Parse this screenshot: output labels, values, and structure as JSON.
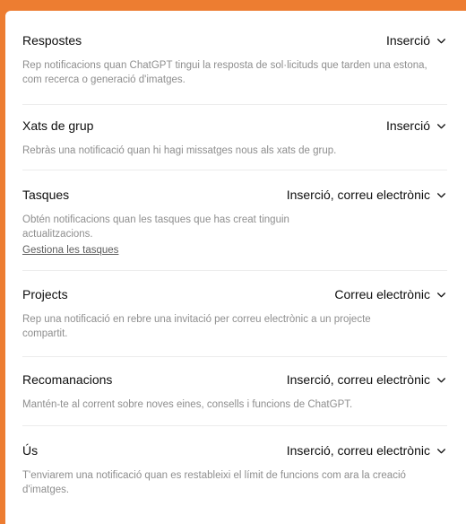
{
  "sections": [
    {
      "title": "Respostes",
      "value": "Inserció",
      "description": "Rep notificacions quan ChatGPT tingui la resposta de sol·licituds que tarden una estona, com recerca o generació d'imatges."
    },
    {
      "title": "Xats de grup",
      "value": "Inserció",
      "description": "Rebràs una notificació quan hi hagi missatges nous als xats de grup."
    },
    {
      "title": "Tasques",
      "value": "Inserció, correu electrònic",
      "description": "Obtén notificacions quan les tasques que has creat tinguin actualitzacions.",
      "link": "Gestiona les tasques"
    },
    {
      "title": "Projects",
      "value": "Correu electrònic",
      "description": "Rep una notificació en rebre una invitació per correu electrònic a un projecte compartit."
    },
    {
      "title": "Recomanacions",
      "value": "Inserció, correu electrònic",
      "description": "Mantén-te al corrent sobre noves eines, consells i funcions de ChatGPT."
    },
    {
      "title": "Ús",
      "value": "Inserció, correu electrònic",
      "description": "T'enviarem una notificació quan es restableixi el límit de funcions com ara la creació d'imatges."
    }
  ],
  "icons": {
    "dropdown": "chevron-down-icon"
  },
  "colors": {
    "frame": "#ed7d31",
    "panel": "#ffffff",
    "title_text": "#0d0d0d",
    "description_text": "#8e8e8e",
    "divider": "#ececec"
  }
}
